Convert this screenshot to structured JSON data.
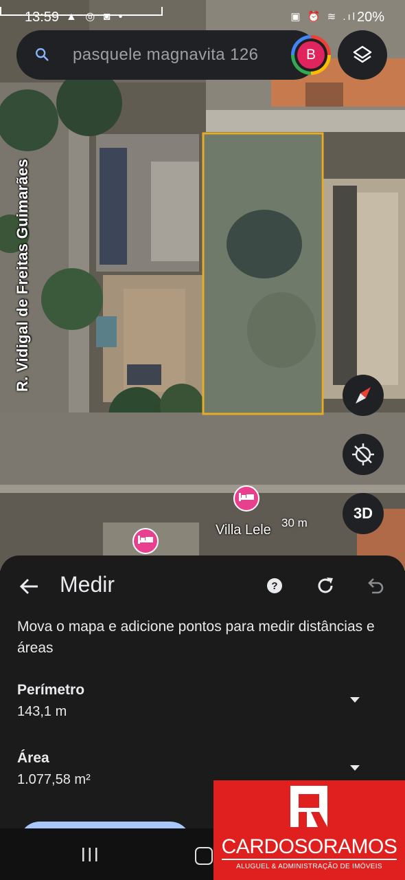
{
  "status_bar": {
    "time": "13:59",
    "left_icons": "▲ ◎ ◙ •",
    "right_icons": "▣ ⏰ ≋ .ıl",
    "battery": "20%"
  },
  "search": {
    "query": "pasquele magnavita 126",
    "icon": "search-icon"
  },
  "account": {
    "avatar_letter": "B"
  },
  "map": {
    "street_label": "R. Vidigal de Freitas Guimarães",
    "place_label": "Villa Lele",
    "scale_label": "30 m",
    "measure_outline_color": "#e3ad2a",
    "pin_color": "#e8408f"
  },
  "controls": {
    "layers": "layers-icon",
    "compass": "compass-icon",
    "location": "gps-off-icon",
    "view_3d_label": "3D"
  },
  "measure_panel": {
    "title": "Medir",
    "description": "Mova o mapa e adicione pontos para medir distâncias e áreas",
    "perimeter_label": "Perímetro",
    "perimeter_value": "143,1 m",
    "area_label": "Área",
    "area_value": "1.077,58 m²"
  },
  "watermark": {
    "brand_name": "CARDOSORAMOS",
    "tagline": "ALUGUEL & ADMINISTRAÇÃO DE IMÓVEIS"
  }
}
